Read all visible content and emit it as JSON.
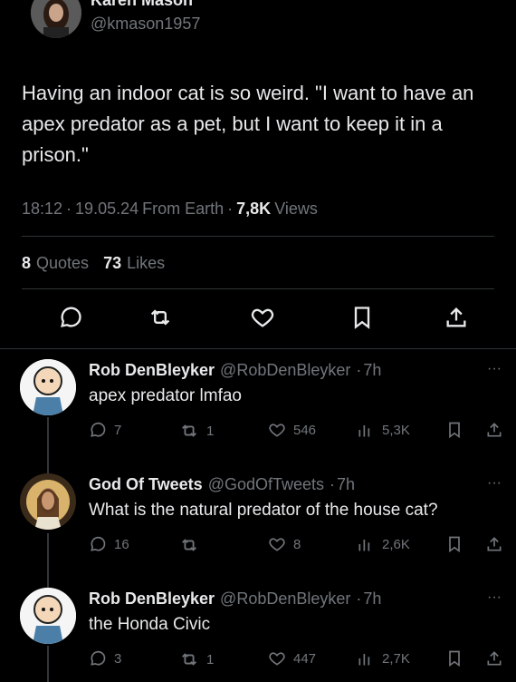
{
  "author": {
    "name": "Karen Mason",
    "handle": "@kmason1957"
  },
  "tweet": {
    "text": "Having an indoor cat is so weird. \"I want to have an apex predator as a pet, but I want to keep it in a prison.\"",
    "time": "18:12",
    "date": "19.05.24",
    "source": "From Earth",
    "views_count": "7,8K",
    "views_label": "Views",
    "quotes_count": "8",
    "quotes_label": "Quotes",
    "likes_count": "73",
    "likes_label": "Likes"
  },
  "replies": [
    {
      "name": "Rob DenBleyker",
      "handle": "@RobDenBleyker",
      "age": "7h",
      "text": "apex predator lmfao",
      "comments": "7",
      "retweets": "1",
      "likes": "546",
      "views": "5,3K"
    },
    {
      "name": "God Of Tweets",
      "handle": "@GodOfTweets",
      "age": "7h",
      "text": "What is the natural predator of the house cat?",
      "comments": "16",
      "retweets": "",
      "likes": "8",
      "views": "2,6K"
    },
    {
      "name": "Rob DenBleyker",
      "handle": "@RobDenBleyker",
      "age": "7h",
      "text": "the Honda Civic",
      "comments": "3",
      "retweets": "1",
      "likes": "447",
      "views": "2,7K"
    }
  ],
  "colors": {
    "background": "#000000",
    "text": "#e7e9ea",
    "muted": "#71767b"
  },
  "icons": [
    "comment-icon",
    "retweet-icon",
    "heart-icon",
    "bookmark-icon",
    "share-icon",
    "views-icon",
    "more-icon"
  ]
}
